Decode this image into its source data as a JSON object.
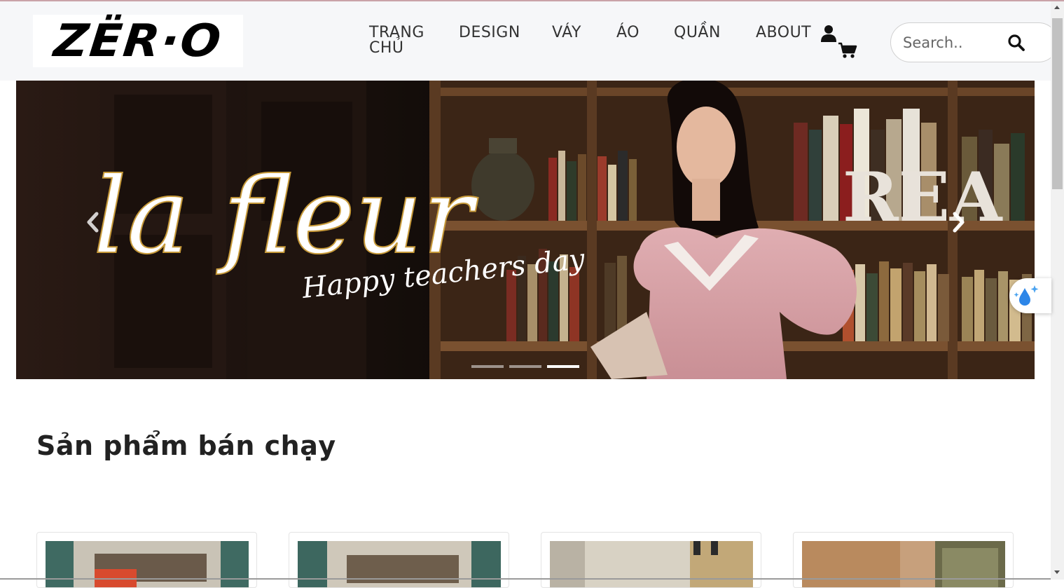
{
  "brand": {
    "logo_text": "ZËR·O"
  },
  "nav": {
    "items": [
      {
        "label_line1": "TRANG",
        "label_line2": "CHỦ"
      },
      {
        "label_line1": "DESIGN"
      },
      {
        "label_line1": "VÁY"
      },
      {
        "label_line1": "ÁO"
      },
      {
        "label_line1": "QUẦN"
      },
      {
        "label_line1": "ABOUT"
      }
    ],
    "user_icon": "user-icon",
    "cart_icon": "shopping-cart-icon"
  },
  "search": {
    "placeholder": "Search..",
    "value": "",
    "icon": "search-icon"
  },
  "banner": {
    "script_title": "la fleur",
    "script_subtitle": "Happy teachers day",
    "background_sign": "REA",
    "slide_count": 3,
    "active_slide": 3,
    "prev_icon": "chevron-left-icon",
    "next_icon": "chevron-right-icon"
  },
  "floating_widget": {
    "icon": "water-drop-sparkle-icon"
  },
  "bestsellers": {
    "title": "Sản phẩm bán chạy",
    "cards": [
      {
        "image": "product-photo"
      },
      {
        "image": "product-photo"
      },
      {
        "image": "product-photo"
      },
      {
        "image": "product-photo"
      }
    ]
  },
  "colors": {
    "header_bg": "#f6f7f9",
    "text": "#333333",
    "dress_pink": "#d9a3a8"
  }
}
